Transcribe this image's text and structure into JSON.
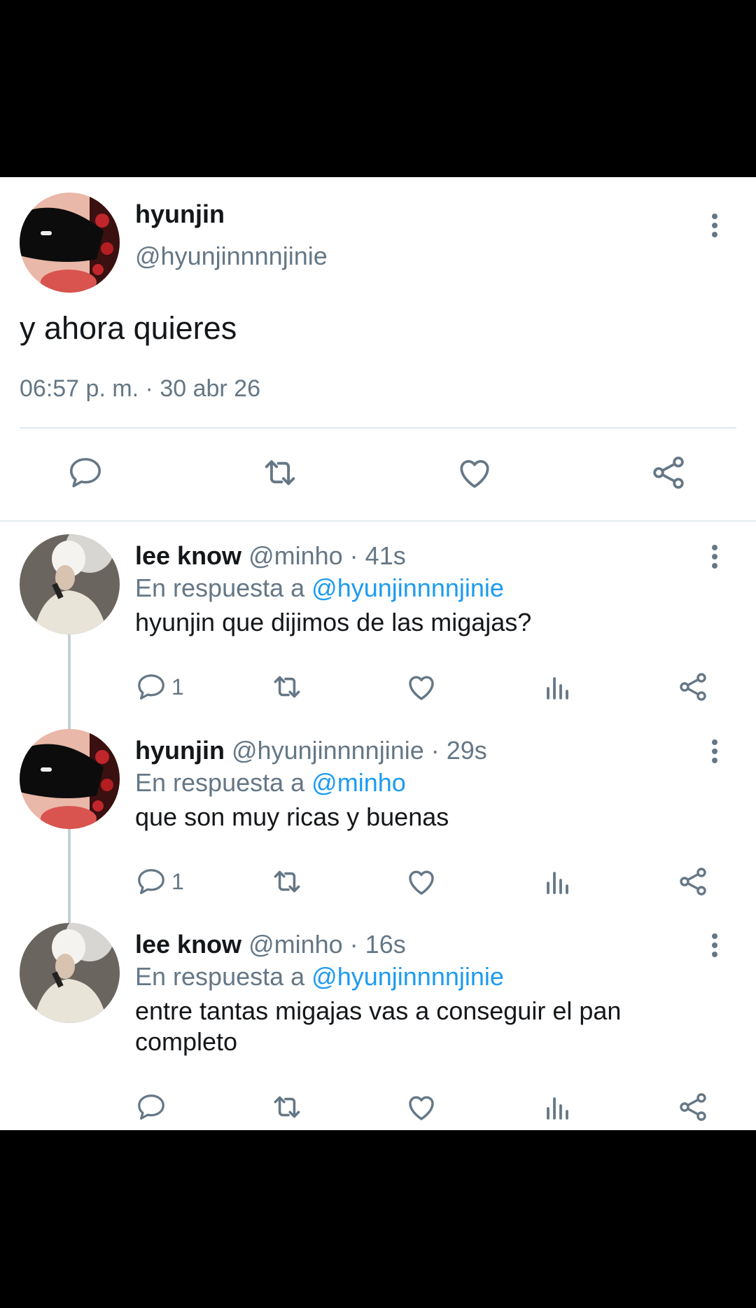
{
  "main_tweet": {
    "name": "hyunjin",
    "handle": "@hyunjinnnnjinie",
    "text": "y ahora quieres",
    "timestamp": "06:57 p. m. · 30 abr 26",
    "actions": [
      "reply-icon",
      "retweet-icon",
      "like-icon",
      "share-icon"
    ]
  },
  "replies": [
    {
      "name": "lee know",
      "meta": "@minho · 41s",
      "in_reply_label": "En respuesta a ",
      "mention": "@hyunjinnnnjinie",
      "text": "hyunjin que dijimos de las migajas?",
      "reply_count": "1"
    },
    {
      "name": "hyunjin",
      "meta": "@hyunjinnnnjinie · 29s",
      "in_reply_label": "En respuesta a ",
      "mention": "@minho",
      "text": "que son muy ricas y buenas",
      "reply_count": "1"
    },
    {
      "name": "lee know",
      "meta": "@minho · 16s",
      "in_reply_label": "En respuesta a ",
      "mention": "@hyunjinnnnjinie",
      "text": "entre tantas migajas vas a conseguir el pan completo",
      "reply_count": ""
    }
  ],
  "colors": {
    "accent": "#1d9bf0",
    "secondary_text": "#657786",
    "primary_text": "#14171a"
  }
}
